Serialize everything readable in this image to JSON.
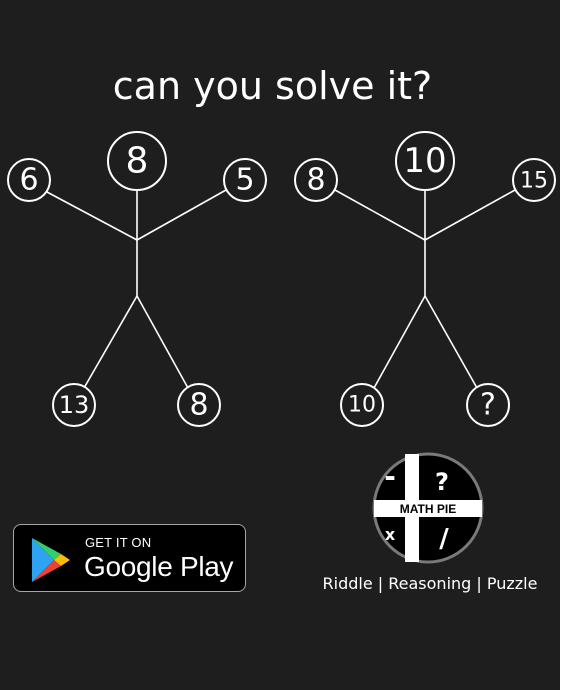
{
  "title": "can you solve it?",
  "figures": [
    {
      "head": "8",
      "left_hand": "6",
      "right_hand": "5",
      "left_foot": "13",
      "right_foot": "8"
    },
    {
      "head": "10",
      "left_hand": "8",
      "right_hand": "15",
      "left_foot": "10",
      "right_foot": "?"
    }
  ],
  "store_badge": {
    "small_text": "GET IT ON",
    "big_text": "Google Play"
  },
  "brand_logo": {
    "name": "MATH PIE",
    "symbols": [
      "-",
      "?",
      "x",
      "/"
    ]
  },
  "tagline": "Riddle | Reasoning | Puzzle",
  "colors": {
    "background": "#1e1e1e",
    "foreground": "#ffffff"
  }
}
